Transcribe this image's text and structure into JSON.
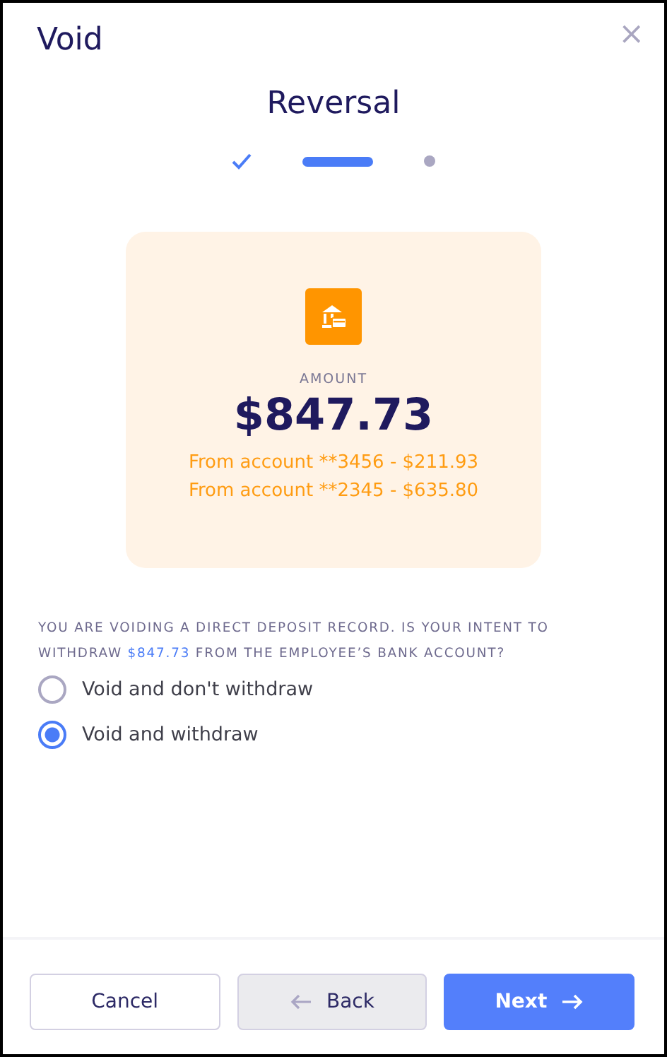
{
  "dialog": {
    "title": "Void",
    "close": "×"
  },
  "heading": "Reversal",
  "steps": [
    {
      "kind": "done",
      "selected": false
    },
    {
      "kind": "current",
      "selected": true
    },
    {
      "kind": "pending",
      "selected": false
    }
  ],
  "amount_card": {
    "label": "AMOUNT",
    "amount": "$847.73",
    "accounts": [
      "From account **3456 - $211.93",
      "From account **2345 - $635.80"
    ]
  },
  "question": "YOU ARE VOIDING A DIRECT DEPOSIT RECORD. IS YOUR INTENT TO WITHDRAW **$847.73** FROM THE EMPLOYEE’S BANK ACCOUNT?",
  "options": [
    {
      "label": "Void and don't withdraw",
      "selected": false
    },
    {
      "label": "Void and withdraw",
      "selected": true
    }
  ],
  "buttons": [
    {
      "kind": "cancel",
      "label": "Cancel"
    },
    {
      "kind": "back",
      "label": "Back"
    },
    {
      "kind": "next",
      "label": "Next"
    }
  ]
}
